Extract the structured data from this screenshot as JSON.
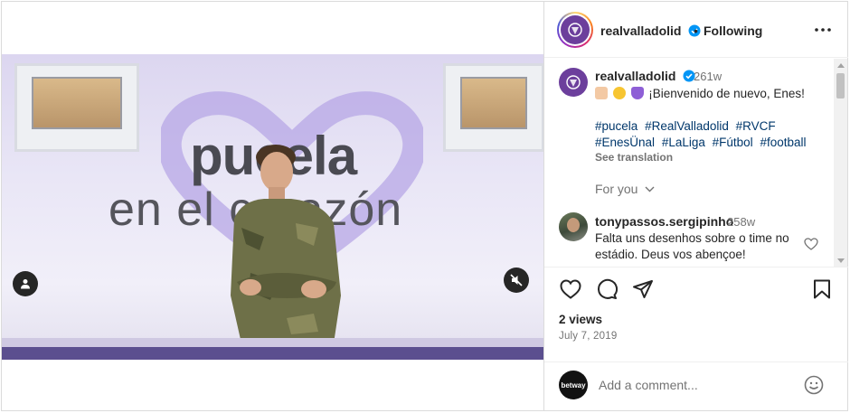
{
  "post": {
    "account": {
      "username": "realvalladolid",
      "verified": true,
      "follow_status": "Following",
      "separator": "•",
      "avatar_icon": "club-crest-icon"
    },
    "media": {
      "wall_text_line1": "pucela",
      "wall_text_line2": "en el corazón",
      "muted": true
    },
    "caption": {
      "username": "realvalladolid",
      "age": "261w",
      "emojis": [
        "clapping-hands-icon",
        "smiling-face-icon",
        "purple-heart-icon"
      ],
      "text": "¡Bienvenido de nuevo, Enes!",
      "hashtags": [
        "#pucela",
        "#RealValladolid",
        "#RVCF",
        "#EnesÜnal",
        "#LaLiga",
        "#Fútbol",
        "#football"
      ],
      "see_translation": "See translation"
    },
    "comments_filter": "For you",
    "comments": [
      {
        "username": "tonypassos.sergipinho",
        "age": "258w",
        "text": "Falta uns desenhos sobre o time no estádio. Deus vos abençoe!"
      }
    ],
    "stats": {
      "views": "2 views",
      "date": "July 7, 2019"
    },
    "add_comment": {
      "placeholder": "Add a comment...",
      "avatar_label": "betway"
    },
    "colors": {
      "link": "#00376b",
      "muted_text": "#737373",
      "verified_blue": "#0095f6",
      "club_purple": "#6c3f9c"
    }
  }
}
